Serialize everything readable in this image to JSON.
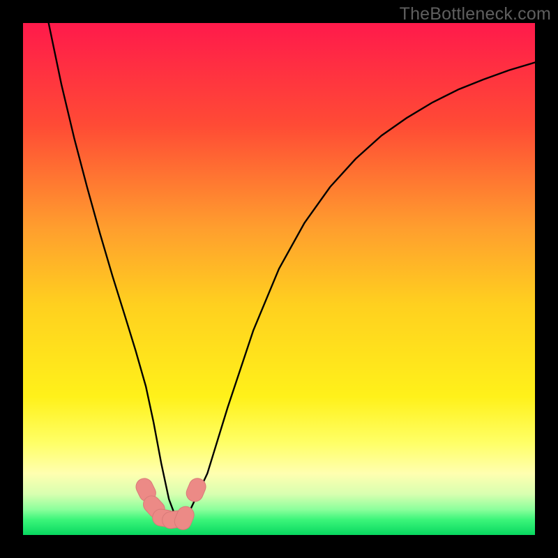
{
  "watermark": "TheBottleneck.com",
  "chart_data": {
    "type": "line",
    "title": "",
    "xlabel": "",
    "ylabel": "",
    "xlim": [
      0,
      100
    ],
    "ylim": [
      0,
      100
    ],
    "grid": false,
    "legend": false,
    "background_gradient": {
      "stops": [
        {
          "offset": 0.0,
          "color": "#ff1a4b"
        },
        {
          "offset": 0.2,
          "color": "#ff4b35"
        },
        {
          "offset": 0.4,
          "color": "#ff9e2e"
        },
        {
          "offset": 0.55,
          "color": "#ffd01f"
        },
        {
          "offset": 0.73,
          "color": "#fff11a"
        },
        {
          "offset": 0.82,
          "color": "#ffff66"
        },
        {
          "offset": 0.88,
          "color": "#ffffb0"
        },
        {
          "offset": 0.92,
          "color": "#d8ffb0"
        },
        {
          "offset": 0.95,
          "color": "#8cff9c"
        },
        {
          "offset": 0.97,
          "color": "#3cf57a"
        },
        {
          "offset": 1.0,
          "color": "#08d860"
        }
      ]
    },
    "series": [
      {
        "name": "curve",
        "x": [
          5.0,
          7.5,
          10.0,
          12.5,
          15.0,
          17.5,
          20.0,
          22.0,
          24.0,
          25.5,
          27.0,
          28.5,
          30.0,
          32.0,
          36.0,
          40.0,
          45.0,
          50.0,
          55.0,
          60.0,
          65.0,
          70.0,
          75.0,
          80.0,
          85.0,
          90.0,
          95.0,
          100.0
        ],
        "y": [
          100.0,
          88.0,
          77.5,
          68.0,
          59.0,
          50.5,
          42.5,
          36.0,
          29.0,
          22.0,
          14.0,
          7.0,
          3.0,
          3.5,
          12.0,
          25.0,
          40.0,
          52.0,
          61.0,
          68.0,
          73.5,
          78.0,
          81.5,
          84.5,
          87.0,
          89.0,
          90.8,
          92.3
        ]
      }
    ],
    "markers": {
      "name": "highlight-points",
      "color": "#ec8a86",
      "stroke": "#d87a78",
      "x": [
        24.0,
        25.6,
        27.6,
        29.5,
        31.5,
        33.8
      ],
      "y": [
        8.8,
        5.5,
        3.3,
        3.0,
        3.3,
        8.8
      ]
    }
  }
}
